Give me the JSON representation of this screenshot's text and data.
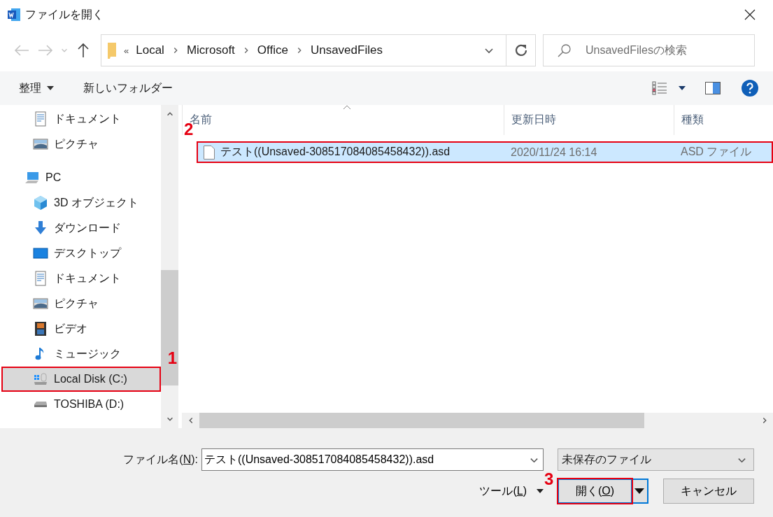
{
  "window": {
    "title": "ファイルを開く"
  },
  "navigation": {
    "back": {
      "disabled": true
    },
    "forward": {
      "disabled": true
    },
    "overflow": "«",
    "path": [
      "Local",
      "Microsoft",
      "Office",
      "UnsavedFiles"
    ],
    "search": {
      "placeholder": "UnsavedFilesの検索"
    }
  },
  "toolbar": {
    "organize": "整理",
    "new_folder": "新しいフォルダー"
  },
  "sidebar": {
    "items": [
      {
        "label": "ドキュメント",
        "kind": "documents",
        "selected": false
      },
      {
        "label": "ピクチャ",
        "kind": "pictures",
        "selected": false
      },
      {
        "label": "PC",
        "kind": "pc",
        "selected": false,
        "children": [
          {
            "label": "3D オブジェクト",
            "kind": "objects",
            "selected": false
          },
          {
            "label": "ダウンロード",
            "kind": "downloads",
            "selected": false
          },
          {
            "label": "デスクトップ",
            "kind": "desktop",
            "selected": false
          },
          {
            "label": "ドキュメント",
            "kind": "documents",
            "selected": false
          },
          {
            "label": "ピクチャ",
            "kind": "pictures",
            "selected": false
          },
          {
            "label": "ビデオ",
            "kind": "videos",
            "selected": false
          },
          {
            "label": "ミュージック",
            "kind": "music",
            "selected": false
          },
          {
            "label": "Local Disk (C:)",
            "kind": "system-drive",
            "selected": true,
            "annotation": "1"
          },
          {
            "label": "TOSHIBA (D:)",
            "kind": "drive",
            "selected": false
          }
        ]
      }
    ]
  },
  "file_list": {
    "columns": [
      "名前",
      "更新日時",
      "種類"
    ],
    "rows": [
      {
        "name": "テスト((Unsaved-308517084085458432)).asd",
        "modified": "2020/11/24 16:14",
        "type": "ASD ファイル",
        "selected": true,
        "annotation": "2"
      }
    ]
  },
  "footer": {
    "filename_label": [
      "ファイル名(",
      "N",
      "):"
    ],
    "filename": "テスト((Unsaved-308517084085458432)).asd",
    "filter": "未保存のファイル",
    "tools": [
      "ツール(",
      "L",
      ")"
    ],
    "open": {
      "label": [
        "開く(",
        "O",
        ")"
      ],
      "annotation": "3"
    },
    "cancel": "キャンセル"
  }
}
